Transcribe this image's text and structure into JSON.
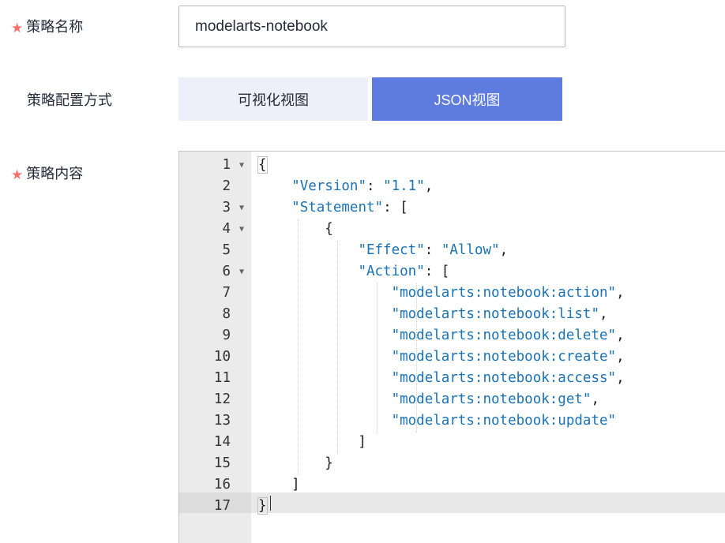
{
  "form": {
    "required_mark": "★",
    "name_label": "策略名称",
    "name_value": "modelarts-notebook",
    "mode_label": "策略配置方式",
    "mode_options": [
      "可视化视图",
      "JSON视图"
    ],
    "mode_selected": "JSON视图",
    "content_label": "策略内容"
  },
  "editor": {
    "fold_icon": "chevron-down-icon",
    "active_line": 17,
    "lines": [
      {
        "n": "1",
        "fold": true
      },
      {
        "n": "2",
        "fold": false
      },
      {
        "n": "3",
        "fold": true
      },
      {
        "n": "4",
        "fold": true
      },
      {
        "n": "5",
        "fold": false
      },
      {
        "n": "6",
        "fold": true
      },
      {
        "n": "7",
        "fold": false
      },
      {
        "n": "8",
        "fold": false
      },
      {
        "n": "9",
        "fold": false
      },
      {
        "n": "10",
        "fold": false
      },
      {
        "n": "11",
        "fold": false
      },
      {
        "n": "12",
        "fold": false
      },
      {
        "n": "13",
        "fold": false
      },
      {
        "n": "14",
        "fold": false
      },
      {
        "n": "15",
        "fold": false
      },
      {
        "n": "16",
        "fold": false
      },
      {
        "n": "17",
        "fold": false
      }
    ],
    "code": [
      "{",
      "    \"Version\": \"1.1\",",
      "    \"Statement\": [",
      "        {",
      "            \"Effect\": \"Allow\",",
      "            \"Action\": [",
      "                \"modelarts:notebook:action\",",
      "                \"modelarts:notebook:list\",",
      "                \"modelarts:notebook:delete\",",
      "                \"modelarts:notebook:create\",",
      "                \"modelarts:notebook:access\",",
      "                \"modelarts:notebook:get\",",
      "                \"modelarts:notebook:update\"",
      "            ]",
      "        }",
      "    ]",
      "}"
    ]
  }
}
